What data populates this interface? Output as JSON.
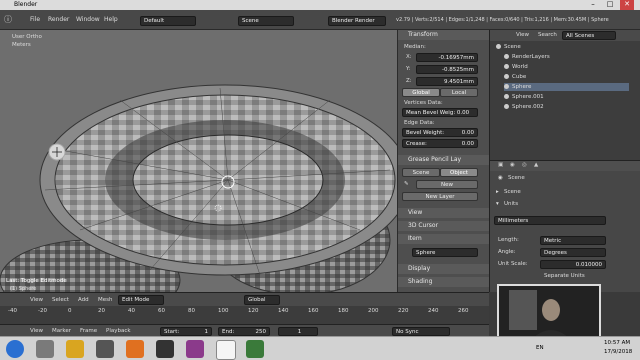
{
  "window": {
    "title": "Blender",
    "minimize": "–",
    "maximize": "□",
    "close": "✕"
  },
  "menu": {
    "items": [
      "File",
      "Render",
      "Window",
      "Help"
    ],
    "layout": "Default",
    "scene": "Scene",
    "engine": "Blender Render",
    "stats": "v2.79 | Verts:2/514 | Edges:1/1,248 | Faces:0/640 | Tris:1,216 | Mem:30.45M | Sphere"
  },
  "viewport": {
    "view": "User Ortho",
    "units": "Meters",
    "operator": "Last: Toggle Editmode",
    "object": "(1) Sphere"
  },
  "transform": {
    "header": "Transform",
    "median_label": "Median:",
    "x": "X:",
    "x_val": "-0.16957mm",
    "y": "Y:",
    "y_val": "-0.8525mm",
    "z": "Z:",
    "z_val": "9.4501mm",
    "global": "Global",
    "local": "Local",
    "vertices_data": "Vertices Data:",
    "mean_bevel": "Mean Bevel Weig: 0.00",
    "edge_data": "Edge Data:",
    "bevel_weight": "Bevel Weight:",
    "bevel_val": "0.00",
    "crease": "Crease:",
    "crease_val": "0.00",
    "grease_pencil": "Grease Pencil Lay",
    "scene_tab": "Scene",
    "object_tab": "Object",
    "new": "New",
    "new_layer": "New Layer",
    "view": "View",
    "cursor": "3D Cursor",
    "item": "Item",
    "item_name": "Sphere",
    "display": "Display",
    "shading": "Shading"
  },
  "outliner": {
    "view": "View",
    "search": "Search",
    "filter": "All Scenes",
    "rows": [
      "Scene",
      "RenderLayers",
      "World",
      "Cube",
      "Sphere",
      "Sphere.001",
      "Sphere.002"
    ]
  },
  "properties": {
    "scene_path": "Scene",
    "scene_section": "Scene",
    "units_section": "Units",
    "preset": "Millimeters",
    "length_label": "Length:",
    "length_val": "Metric",
    "angle_label": "Angle:",
    "angle_val": "Degrees",
    "scale_label": "Unit Scale:",
    "scale_val": "0.010000",
    "separate": "Separate Units"
  },
  "view_header": {
    "view": "View",
    "select": "Select",
    "add": "Add",
    "mesh": "Mesh",
    "mode": "Edit Mode",
    "orientation": "Global"
  },
  "timeline": {
    "ticks": [
      "-40",
      "-20",
      "0",
      "20",
      "40",
      "60",
      "80",
      "100",
      "120",
      "140",
      "160",
      "180",
      "200",
      "220",
      "240",
      "260"
    ],
    "view": "View",
    "marker": "Marker",
    "frame": "Frame",
    "playback": "Playback",
    "start_label": "Start:",
    "start_val": "1",
    "end_label": "End:",
    "end_val": "250",
    "current": "1",
    "sync": "No Sync"
  },
  "taskbar": {
    "lang": "EN",
    "time": "10:57 AM",
    "date": "17/9/2018"
  },
  "colors": {
    "accent": "#5680c2",
    "header": "#5a5a5a"
  }
}
